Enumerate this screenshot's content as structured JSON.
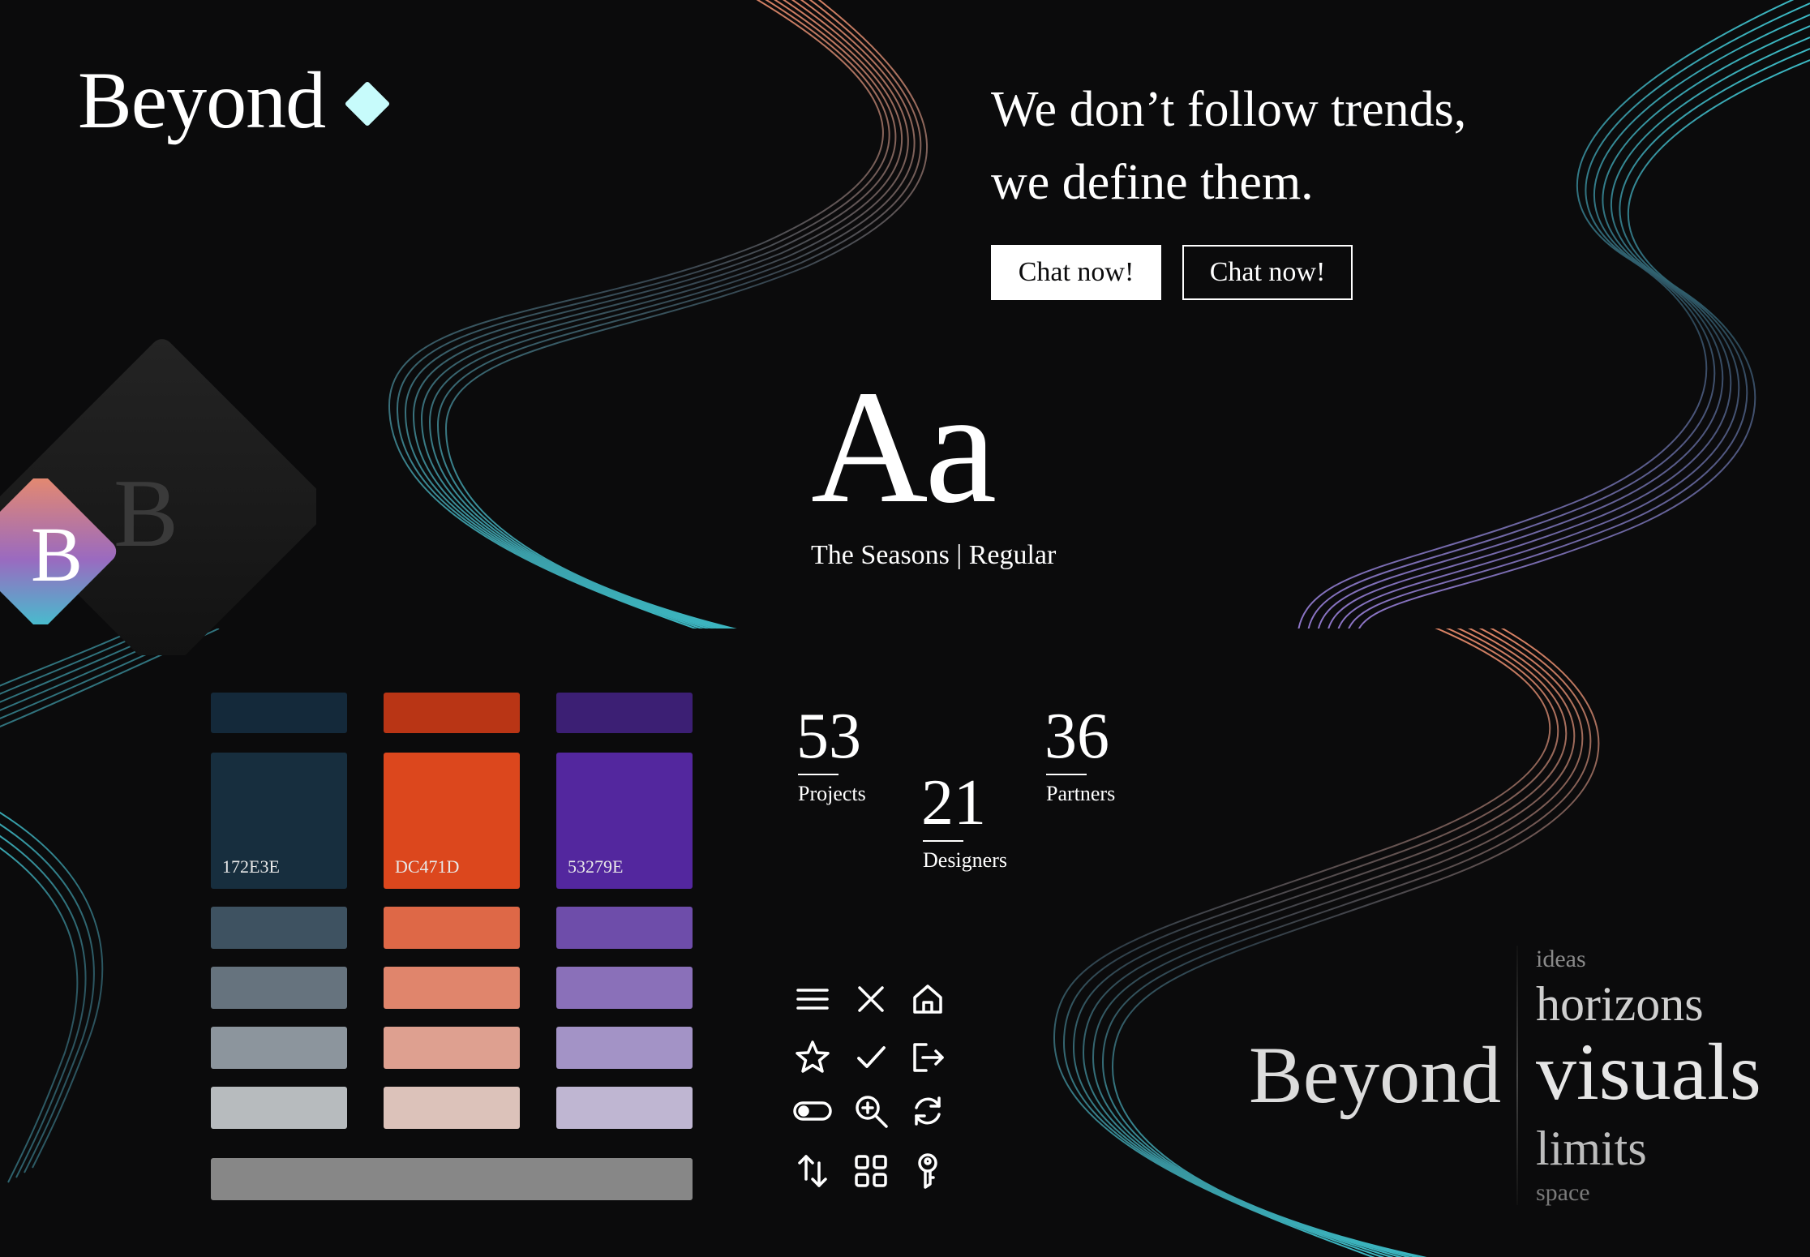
{
  "brand": {
    "name": "Beyond",
    "accent_color": "#C7FBFB",
    "app_icon_letter": "B"
  },
  "tagline": {
    "line1": "We don’t follow trends,",
    "line2": "we define them."
  },
  "buttons": {
    "primary_label": "Chat now!",
    "secondary_label": "Chat now!"
  },
  "typography": {
    "specimen": "Aa",
    "caption": "The Seasons | Regular"
  },
  "palette": {
    "columns": [
      {
        "base_hex": "172E3E",
        "tints": [
          "#14293A",
          "#172E3E",
          "#3E5261",
          "#66737E",
          "#8C959D",
          "#B7BBBE"
        ]
      },
      {
        "base_hex": "DC471D",
        "tints": [
          "#B93515",
          "#DC471D",
          "#DE6847",
          "#E0856C",
          "#DEA090",
          "#DCC2BA"
        ]
      },
      {
        "base_hex": "53279E",
        "tints": [
          "#3C1F74",
          "#53279E",
          "#6E4DAA",
          "#8A70B9",
          "#A393C6",
          "#BFB6D2"
        ]
      }
    ],
    "neutral": "#878787"
  },
  "stats": [
    {
      "value": "53",
      "label": "Projects"
    },
    {
      "value": "21",
      "label": "Designers"
    },
    {
      "value": "36",
      "label": "Partners"
    }
  ],
  "icons": [
    "menu-icon",
    "close-icon",
    "home-icon",
    "star-icon",
    "check-icon",
    "logout-icon",
    "toggle-icon",
    "zoom-in-icon",
    "refresh-icon",
    "sort-icon",
    "grid-icon",
    "key-icon"
  ],
  "wordstack": {
    "main": "Beyond",
    "words": [
      "ideas",
      "horizons",
      "visuals",
      "limits",
      "space"
    ]
  },
  "colors": {
    "background": "#0B0B0C",
    "ribbon_teal": "#3FC4CF",
    "ribbon_peach": "#E98B6A",
    "ribbon_violet": "#9A7ED8"
  }
}
